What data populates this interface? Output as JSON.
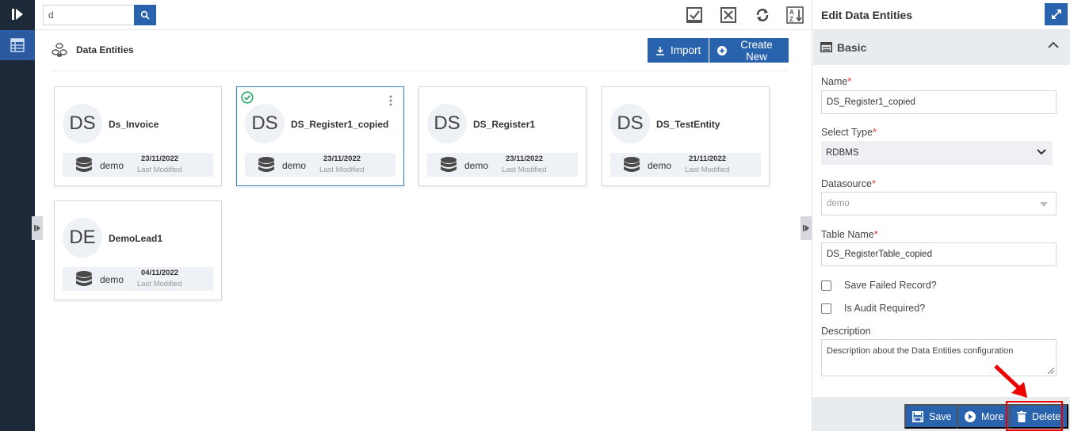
{
  "search": {
    "value": "d"
  },
  "page": {
    "title": "Data Entities"
  },
  "actions": {
    "import_label": "Import",
    "create_label": "Create New"
  },
  "toolbar": {
    "icons": [
      "select-all-icon",
      "deselect-all-icon",
      "refresh-icon",
      "sort-az-icon"
    ]
  },
  "cards": [
    {
      "initials": "DS",
      "name": "Ds_Invoice",
      "datasource": "demo",
      "date": "23/11/2022",
      "modified_label": "Last Modified"
    },
    {
      "initials": "DS",
      "name": "DS_Register1_copied",
      "datasource": "demo",
      "date": "23/11/2022",
      "modified_label": "Last Modified",
      "selected": true
    },
    {
      "initials": "DS",
      "name": "DS_Register1",
      "datasource": "demo",
      "date": "23/11/2022",
      "modified_label": "Last Modified"
    },
    {
      "initials": "DS",
      "name": "DS_TestEntity",
      "datasource": "demo",
      "date": "21/11/2022",
      "modified_label": "Last Modified"
    },
    {
      "initials": "DE",
      "name": "DemoLead1",
      "datasource": "demo",
      "date": "04/11/2022",
      "modified_label": "Last Modified"
    }
  ],
  "panel": {
    "title": "Edit Data Entities",
    "section_title": "Basic",
    "name_label": "Name",
    "name_value": "DS_Register1_copied",
    "type_label": "Select Type",
    "type_value": "RDBMS",
    "datasource_label": "Datasource",
    "datasource_value": "demo",
    "table_label": "Table Name",
    "table_value": "DS_RegisterTable_copied",
    "save_failed_label": "Save Failed Record?",
    "audit_label": "Is Audit Required?",
    "description_label": "Description",
    "description_value": "Description about the Data Entities configuration",
    "required_mark": "*"
  },
  "footer": {
    "save_label": "Save",
    "more_label": "More",
    "delete_label": "Delete"
  },
  "colors": {
    "accent": "#2a63ad",
    "rail": "#1d2939",
    "highlight": "#e00000"
  }
}
